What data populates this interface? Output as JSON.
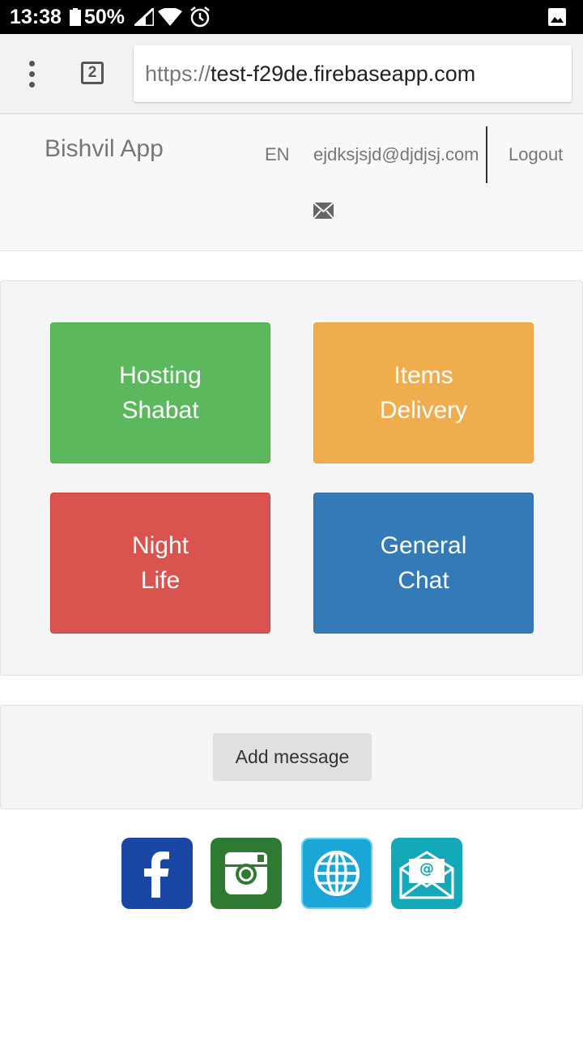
{
  "status_bar": {
    "time": "13:38",
    "battery": "50%"
  },
  "browser": {
    "tab_count": "2",
    "url_protocol": "https://",
    "url_host": "test-f29de.firebaseapp.com"
  },
  "navbar": {
    "brand": "Bishvil App",
    "language": "EN",
    "email": "ejdksjsjd@djdjsj.com",
    "logout": "Logout"
  },
  "tiles": [
    {
      "line1": "Hosting",
      "line2": "Shabat",
      "color": "#5cb85c"
    },
    {
      "line1": "Items",
      "line2": "Delivery",
      "color": "#f0ad4e"
    },
    {
      "line1": "Night",
      "line2": "Life",
      "color": "#d9534f"
    },
    {
      "line1": "General",
      "line2": "Chat",
      "color": "#337ab7"
    }
  ],
  "actions": {
    "add_message": "Add message"
  },
  "social_icons": [
    "facebook-icon",
    "instagram-icon",
    "globe-icon",
    "email-icon"
  ]
}
